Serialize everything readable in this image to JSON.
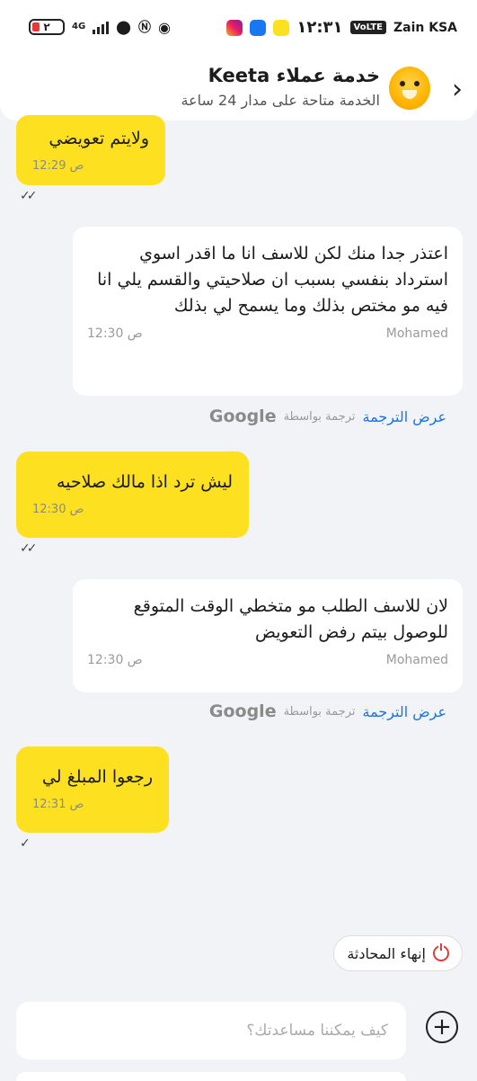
{
  "status_bar": {
    "battery": "٢",
    "network": "4G",
    "time": "١٢:٣١",
    "volte": "VoLTE",
    "carrier": "Zain KSA"
  },
  "header": {
    "title": "خدمة عملاء Keeta",
    "subtitle": "الخدمة متاحة على مدار 24 ساعة"
  },
  "messages": [
    {
      "text": "ولايتم تعويضي",
      "time": "12:29 ص"
    },
    {
      "text": "اعتذر جدا منك لكن للاسف انا ما اقدر اسوي استرداد بنفسي بسبب ان صلاحيتي والقسم يلي انا فيه مو مختص بذلك وما يسمح لي بذلك",
      "sender": "Mohamed",
      "time": "12:30 ص"
    },
    {
      "text": "ليش ترد اذا مالك صلاحيه",
      "time": "12:30 ص"
    },
    {
      "text": "لان للاسف الطلب مو متخطي الوقت المتوقع للوصول بيتم رفض التعويض",
      "sender": "Mohamed",
      "time": "12:30 ص"
    },
    {
      "text": "رجعوا المبلغ لي",
      "time": "12:31 ص"
    }
  ],
  "translation": {
    "show": "عرض الترجمة",
    "by": "ترجمة بواسطة",
    "brand": "Google"
  },
  "end_button": "إنهاء المحادثة",
  "input": {
    "placeholder": "كيف يمكننا مساعدتك؟"
  },
  "colors": {
    "user_bubble": "#fde01f",
    "link": "#1a73e8",
    "end_icon": "#e53935"
  }
}
